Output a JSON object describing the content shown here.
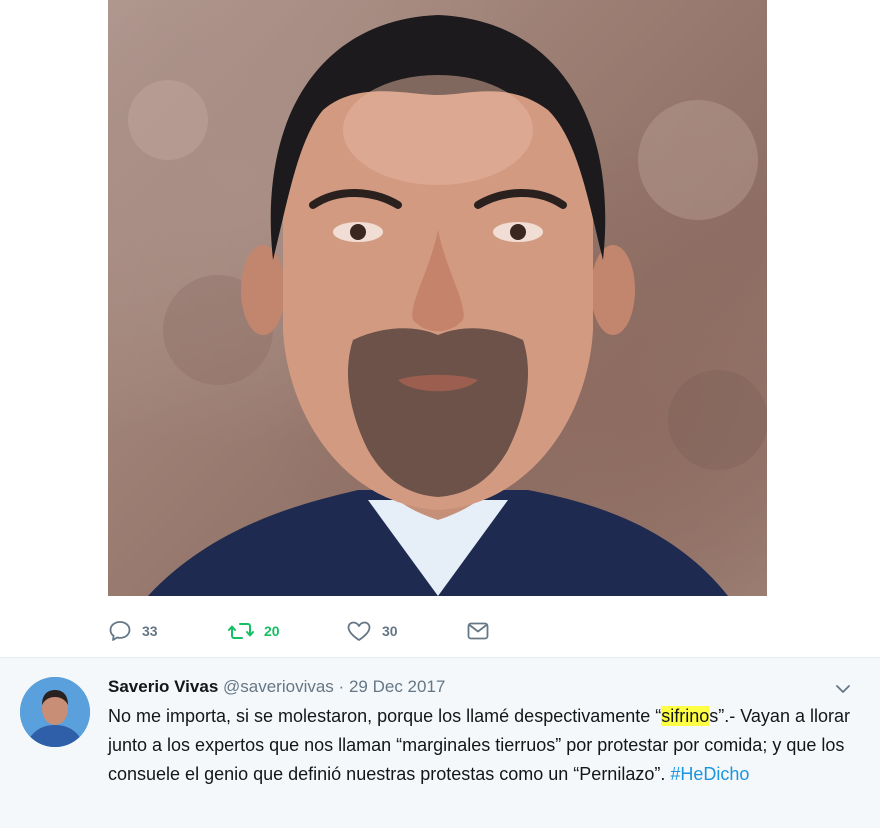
{
  "tweet": {
    "actions": {
      "reply_count": "33",
      "retweet_count": "20",
      "like_count": "30"
    }
  },
  "reply": {
    "name": "Saverio Vivas",
    "handle": "@saveriovivas",
    "separator": "·",
    "date": "29 Dec 2017",
    "text_before": "No me importa, si se molestaron, porque los llamé despectivamente “",
    "highlight": "sifrino",
    "text_after": "s”.- Vayan a llorar junto a los expertos que nos llaman “marginales tierruos” por protestar por comida; y que los consuele el genio que definió nuestras protestas como un “Pernilazo”. ",
    "hashtag": "#HeDicho"
  },
  "colors": {
    "text": "#14171a",
    "muted": "#657786",
    "retweet_green": "#17bf63",
    "link_blue": "#1b95e0",
    "highlight": "#ffff44",
    "reply_background": "#f5f8fa"
  },
  "icons": [
    "reply-icon",
    "retweet-icon",
    "like-icon",
    "message-icon",
    "chevron-down-icon"
  ]
}
